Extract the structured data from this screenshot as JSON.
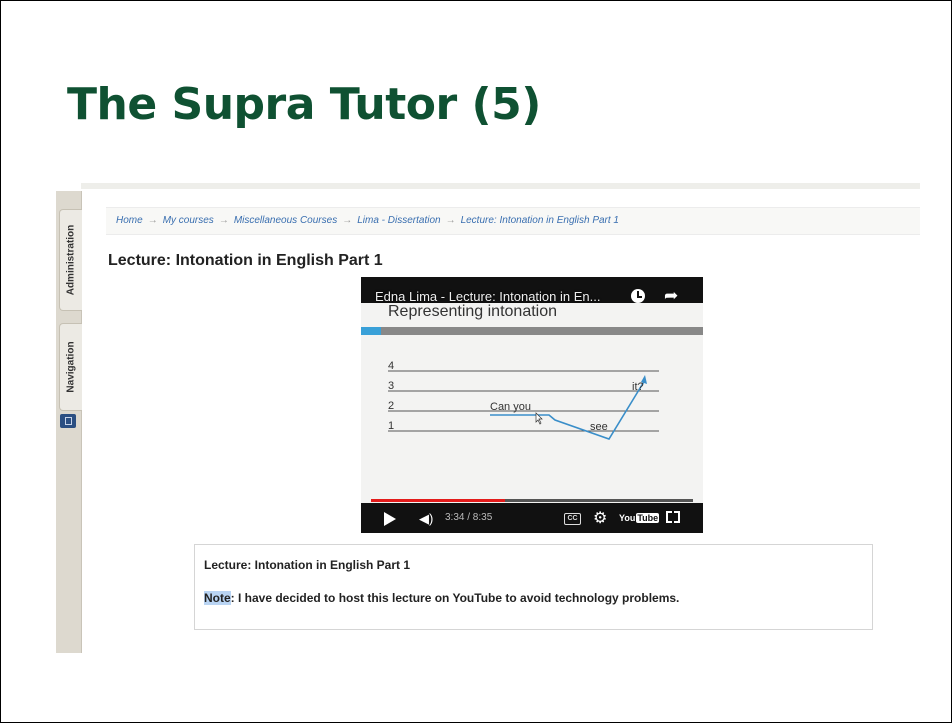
{
  "slide": {
    "title": "The Supra Tutor (5)",
    "title_color": "#0f5132"
  },
  "moodle": {
    "dock": {
      "administration_label": "Administration",
      "navigation_label": "Navigation",
      "dock_button_icon": "dock-icon"
    },
    "breadcrumb": {
      "items": [
        "Home",
        "My courses",
        "Miscellaneous Courses",
        "Lima - Dissertation",
        "Lecture: Intonation in English Part 1"
      ],
      "separator": "→"
    },
    "page_heading": "Lecture: Intonation in English Part 1",
    "video": {
      "title": "Edna Lima - Lecture: Intonation in En...",
      "frame_title": "Representing intonation",
      "levels": [
        "4",
        "3",
        "2",
        "1"
      ],
      "words": {
        "can_you": "Can you",
        "see": "see",
        "it": "it?"
      },
      "time": "3:34 / 8:35",
      "progress": 0.415,
      "cc_label": "CC",
      "youtube_logo_you": "You",
      "youtube_logo_tube": "Tube",
      "icons": [
        "clock-icon",
        "share-icon",
        "play-icon",
        "volume-icon",
        "cc-icon",
        "gear-icon",
        "fullscreen-icon"
      ],
      "accent": "#e31b1b",
      "contour_color": "#3a8ec9"
    },
    "note_box": {
      "heading": "Lecture: Intonation in English Part 1",
      "label": "Note",
      "text": ": I have decided to host this lecture on YouTube to avoid technology problems."
    }
  }
}
